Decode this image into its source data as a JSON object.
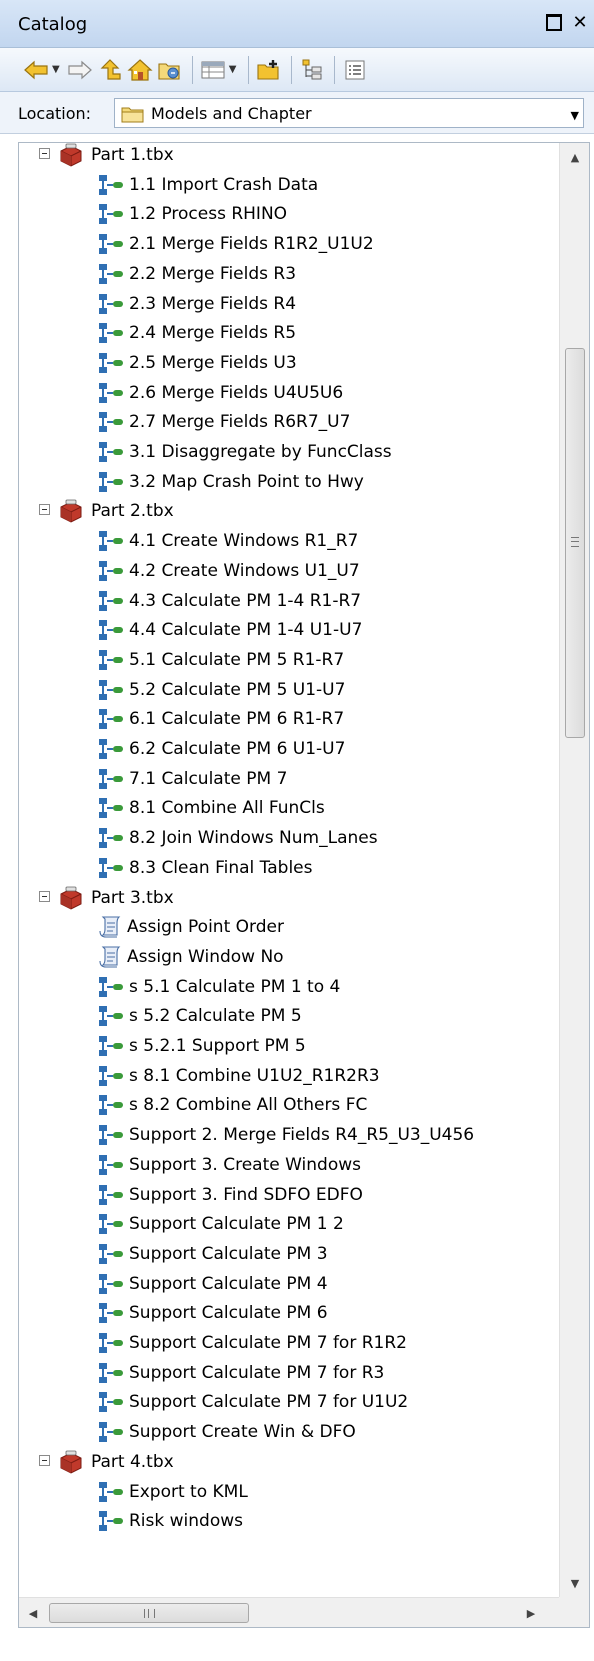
{
  "window": {
    "title": "Catalog"
  },
  "location": {
    "label": "Location:",
    "value": "Models and Chapter"
  },
  "toolboxes": [
    {
      "label": "Part 1.tbx",
      "items": [
        {
          "label": "1.1 Import Crash Data",
          "icon": "model-icon"
        },
        {
          "label": "1.2 Process RHINO",
          "icon": "model-icon"
        },
        {
          "label": "2.1 Merge Fields R1R2_U1U2",
          "icon": "model-icon"
        },
        {
          "label": "2.2 Merge Fields R3",
          "icon": "model-icon"
        },
        {
          "label": "2.3 Merge Fields R4",
          "icon": "model-icon"
        },
        {
          "label": "2.4 Merge Fields R5",
          "icon": "model-icon"
        },
        {
          "label": "2.5 Merge Fields U3",
          "icon": "model-icon"
        },
        {
          "label": "2.6 Merge Fields U4U5U6",
          "icon": "model-icon"
        },
        {
          "label": "2.7 Merge Fields R6R7_U7",
          "icon": "model-icon"
        },
        {
          "label": "3.1 Disaggregate by FuncClass",
          "icon": "model-icon"
        },
        {
          "label": "3.2 Map Crash Point to Hwy",
          "icon": "model-icon"
        }
      ]
    },
    {
      "label": "Part 2.tbx",
      "items": [
        {
          "label": "4.1 Create Windows R1_R7",
          "icon": "model-icon"
        },
        {
          "label": "4.2 Create Windows U1_U7",
          "icon": "model-icon"
        },
        {
          "label": "4.3 Calculate PM 1-4 R1-R7",
          "icon": "model-icon"
        },
        {
          "label": "4.4 Calculate PM 1-4 U1-U7",
          "icon": "model-icon"
        },
        {
          "label": "5.1 Calculate PM 5 R1-R7",
          "icon": "model-icon"
        },
        {
          "label": "5.2 Calculate PM 5 U1-U7",
          "icon": "model-icon"
        },
        {
          "label": "6.1 Calculate PM 6 R1-R7",
          "icon": "model-icon"
        },
        {
          "label": "6.2 Calculate PM 6 U1-U7",
          "icon": "model-icon"
        },
        {
          "label": "7.1 Calculate PM 7",
          "icon": "model-icon"
        },
        {
          "label": "8.1 Combine All FunCls",
          "icon": "model-icon"
        },
        {
          "label": "8.2 Join Windows Num_Lanes",
          "icon": "model-icon"
        },
        {
          "label": "8.3 Clean Final Tables",
          "icon": "model-icon"
        }
      ]
    },
    {
      "label": "Part 3.tbx",
      "items": [
        {
          "label": "Assign Point Order",
          "icon": "script-icon"
        },
        {
          "label": "Assign Window No",
          "icon": "script-icon"
        },
        {
          "label": "s 5.1 Calculate PM 1 to 4",
          "icon": "model-icon"
        },
        {
          "label": "s 5.2 Calculate PM 5",
          "icon": "model-icon"
        },
        {
          "label": "s 5.2.1 Support PM 5",
          "icon": "model-icon"
        },
        {
          "label": "s 8.1 Combine U1U2_R1R2R3",
          "icon": "model-icon"
        },
        {
          "label": "s 8.2 Combine All Others FC",
          "icon": "model-icon"
        },
        {
          "label": "Support 2. Merge Fields R4_R5_U3_U456",
          "icon": "model-icon"
        },
        {
          "label": "Support 3. Create Windows",
          "icon": "model-icon"
        },
        {
          "label": "Support 3. Find SDFO EDFO",
          "icon": "model-icon"
        },
        {
          "label": "Support Calculate PM 1 2",
          "icon": "model-icon"
        },
        {
          "label": "Support Calculate PM 3",
          "icon": "model-icon"
        },
        {
          "label": "Support Calculate PM 4",
          "icon": "model-icon"
        },
        {
          "label": "Support Calculate PM 6",
          "icon": "model-icon"
        },
        {
          "label": "Support Calculate PM 7 for R1R2",
          "icon": "model-icon"
        },
        {
          "label": "Support Calculate PM 7 for R3",
          "icon": "model-icon"
        },
        {
          "label": "Support Calculate PM 7 for U1U2",
          "icon": "model-icon"
        },
        {
          "label": "Support Create Win & DFO",
          "icon": "model-icon"
        }
      ]
    },
    {
      "label": "Part 4.tbx",
      "items": [
        {
          "label": "Export to KML",
          "icon": "model-icon"
        },
        {
          "label": "Risk windows",
          "icon": "model-icon"
        }
      ]
    }
  ],
  "colors": {
    "titlebar": "#c9dbf1",
    "toolbox_red": "#c0392b",
    "model_blue": "#2f6fb3",
    "model_green": "#3a9a3a"
  }
}
